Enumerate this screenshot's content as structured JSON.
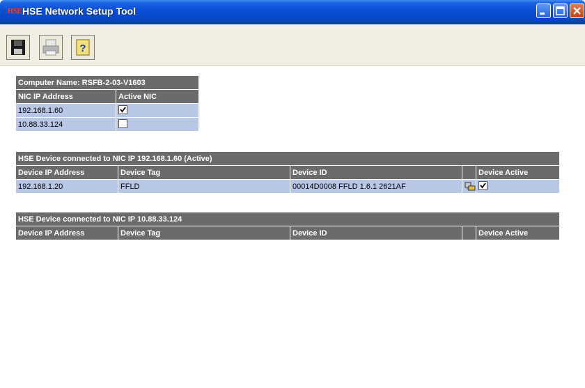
{
  "window": {
    "title": "HSE Network Setup Tool",
    "app_icon_text": "HSE"
  },
  "toolbar": {
    "buttons": [
      "save-icon",
      "print-icon",
      "help-icon"
    ]
  },
  "computer": {
    "name_label": "Computer Name: RSFB-2-03-V1603",
    "columns": [
      "NIC IP Address",
      "Active NIC"
    ],
    "rows": [
      {
        "ip": "192.168.1.60",
        "active": true
      },
      {
        "ip": "10.88.33.124",
        "active": false
      }
    ]
  },
  "section1": {
    "title": "HSE Device connected to NIC IP 192.168.1.60 (Active)",
    "columns": [
      "Device IP Address",
      "Device Tag",
      "Device ID",
      "",
      "Device Active"
    ],
    "rows": [
      {
        "ip": "192.168.1.20",
        "tag": "FFLD",
        "id": "00014D0008 FFLD 1.6.1 2621AF",
        "active": true
      }
    ]
  },
  "section2": {
    "title": "HSE Device connected to NIC IP 10.88.33.124",
    "columns": [
      "Device IP Address",
      "Device Tag",
      "Device ID",
      "",
      "Device Active"
    ]
  },
  "colors": {
    "header_bg": "#6b6b6b",
    "row_bg": "#b9c7e6",
    "titlebar": "#0747c8"
  }
}
